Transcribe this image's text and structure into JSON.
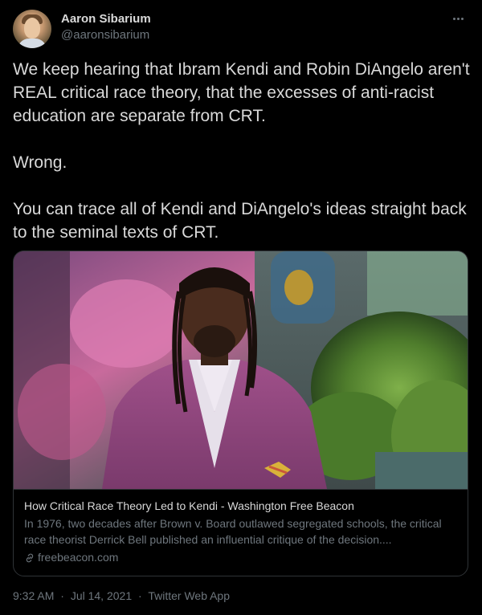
{
  "author": {
    "display_name": "Aaron Sibarium",
    "handle": "@aaronsibarium",
    "avatar_icon": "profile-photo"
  },
  "tweet": {
    "paragraphs": [
      "We keep hearing that Ibram Kendi and Robin DiAngelo aren't REAL critical race theory, that the excesses of anti-racist education are separate from CRT.",
      "Wrong.",
      "You can trace all of Kendi and DiAngelo's ideas straight back to the seminal texts of CRT."
    ]
  },
  "link_card": {
    "title": "How Critical Race Theory Led to Kendi - Washington Free Beacon",
    "description": "In 1976, two decades after Brown v. Board outlawed segregated schools, the critical race theorist Derrick Bell published an influential critique of the decision....",
    "domain": "freebeacon.com",
    "domain_icon": "link-icon",
    "image_icon": "article-photo"
  },
  "footer": {
    "time": "9:32 AM",
    "date": "Jul 14, 2021",
    "source": "Twitter Web App",
    "separator": "·"
  },
  "colors": {
    "background": "#000000",
    "text": "#d9d9d9",
    "secondary_text": "#6e767d",
    "border": "#2f3336"
  },
  "menu_icon": "more-horizontal-icon"
}
